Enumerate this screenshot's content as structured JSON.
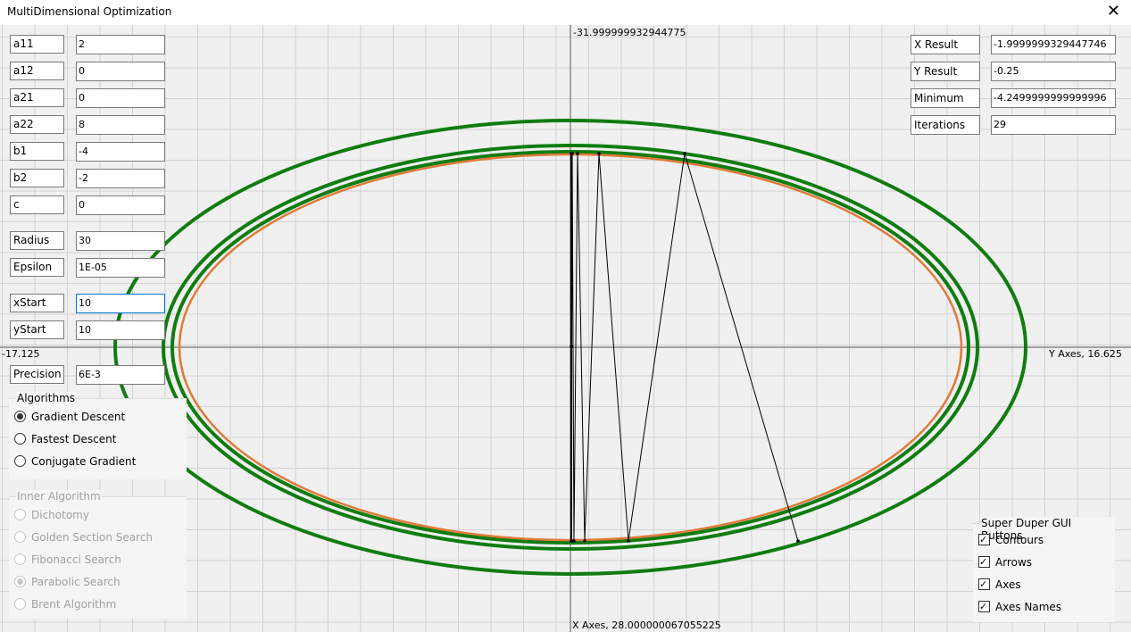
{
  "window": {
    "title": "MultiDimensional Optimization",
    "close_label": "✕"
  },
  "axes": {
    "top_label": "-31.999999932944775",
    "left_label": "-17.125",
    "right_label": "Y Axes, 16.625",
    "bottom_label": "X Axes, 28.000000067055225"
  },
  "params": [
    {
      "label": "a11",
      "value": "2"
    },
    {
      "label": "a12",
      "value": "0"
    },
    {
      "label": "a21",
      "value": "0"
    },
    {
      "label": "a22",
      "value": "8"
    },
    {
      "label": "b1",
      "value": "-4"
    },
    {
      "label": "b2",
      "value": "-2"
    },
    {
      "label": "c",
      "value": "0"
    },
    {
      "label": "Radius",
      "value": "30"
    },
    {
      "label": "Epsilon",
      "value": "1E-05"
    },
    {
      "label": "xStart",
      "value": "10"
    },
    {
      "label": "yStart",
      "value": "10"
    },
    {
      "label": "Precision",
      "value": "6E-3"
    }
  ],
  "results": [
    {
      "label": "X Result",
      "value": "-1.9999999329447746"
    },
    {
      "label": "Y Result",
      "value": "-0.25"
    },
    {
      "label": "Minimum",
      "value": "-4.2499999999999996"
    },
    {
      "label": "Iterations",
      "value": "29"
    }
  ],
  "algorithms": {
    "title": "Algorithms",
    "options": [
      "Gradient Descent",
      "Fastest Descent",
      "Conjugate Gradient"
    ],
    "selected": "Gradient Descent"
  },
  "inner_algorithm": {
    "title": "Inner Algorithm",
    "options": [
      "Dichotomy",
      "Golden Section Search",
      "Fibonacci Search",
      "Parabolic Search",
      "Brent Algorithm"
    ],
    "selected": "Parabolic Search"
  },
  "gui_buttons": {
    "title": "Super Duper GUI Buttons",
    "options": [
      "Contours",
      "Arrows",
      "Axes",
      "Axes Names"
    ]
  },
  "colors": {
    "contour": "#107c10",
    "contour_inner": "#e07a3a",
    "path": "#000000"
  }
}
